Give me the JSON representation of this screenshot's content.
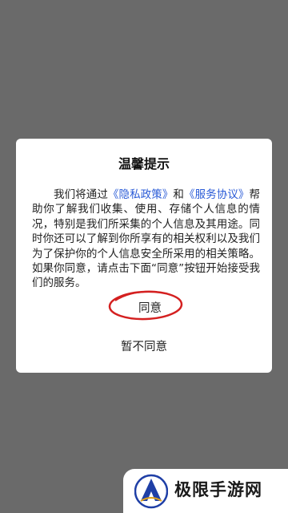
{
  "dialog": {
    "title": "温馨提示",
    "body": {
      "part1": "我们将通过",
      "privacy_link": "《隐私政策》",
      "part2": "和",
      "service_link": "《服务协议》",
      "part3": "帮助你了解我们收集、使用、存储个人信息的情况，特别是我们所采集的个人信息及其用途。同时你还可以了解到你所享有的相关权利以及我们为了保护你的个人信息安全所采用的相关策略。如果你同意，请点击下面“同意”按钮开始接受我们的服务。"
    },
    "agree_label": "同意",
    "disagree_label": "暂不同意"
  },
  "watermark": {
    "text": "极限手游网",
    "logo_icon": "triangle-logo-icon"
  },
  "colors": {
    "overlay": "#6a6a6a",
    "link": "#2a5bd7",
    "highlight_circle": "#d42020",
    "logo_blue": "#1f3fa6"
  }
}
